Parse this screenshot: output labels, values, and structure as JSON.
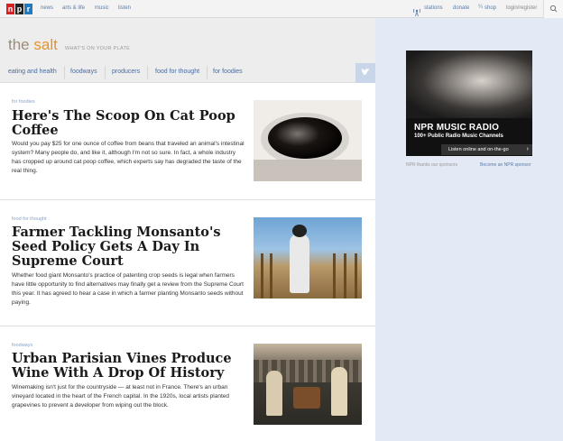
{
  "topbar": {
    "logo_letters": [
      "n",
      "p",
      "r"
    ],
    "logo_colors": [
      "#d62021",
      "#222222",
      "#237bbd"
    ],
    "nav": [
      "news",
      "arts & life",
      "music",
      "listen"
    ],
    "stations_label": "stations",
    "donate_label": "donate",
    "shop_label": "shop",
    "login_label": "login/register"
  },
  "header": {
    "brand_the": "the",
    "brand_salt": "salt",
    "tagline": "WHAT'S ON YOUR PLATE",
    "subnav": [
      "eating and health",
      "foodways",
      "producers",
      "food for thought",
      "for foodies"
    ]
  },
  "articles": [
    {
      "kicker": "for foodies",
      "title": "Here's The Scoop On Cat Poop Coffee",
      "teaser": "Would you pay $25 for one ounce of coffee from beans that traveled an animal's intestinal system? Many people do, and like it, although I'm not so sure. In fact, a whole industry has cropped up around cat poop coffee, which experts say has degraded the taste of the real thing."
    },
    {
      "kicker": "food for thought",
      "title": "Farmer Tackling Monsanto's Seed Policy Gets A Day In Supreme Court",
      "teaser": "Whether food giant Monsanto's practice of patenting crop seeds is legal when farmers have little opportunity to find alternatives may finally get a review from the Supreme Court this year. It has agreed to hear a case in which a farmer planting Monsanto seeds without paying."
    },
    {
      "kicker": "foodways",
      "title": "Urban Parisian Vines Produce Wine With A Drop Of History",
      "teaser": "Winemaking isn't just for the countryside — at least not in France. There's an urban vineyard located in the heart of the French capital. In the 1920s, local artists planted grapevines to prevent a developer from wiping out the block."
    }
  ],
  "ad": {
    "title": "NPR MUSIC RADIO",
    "subtitle": "100+ Public Radio Music Channels",
    "cta": "Listen online and on-the-go",
    "thanks": "NPR thanks our sponsors",
    "sponsor_link": "Become an NPR sponsor"
  },
  "colors": {
    "link": "#4a6b99",
    "brand_salt": "#e6932f",
    "rightcol_bg": "#e3e9f5"
  }
}
